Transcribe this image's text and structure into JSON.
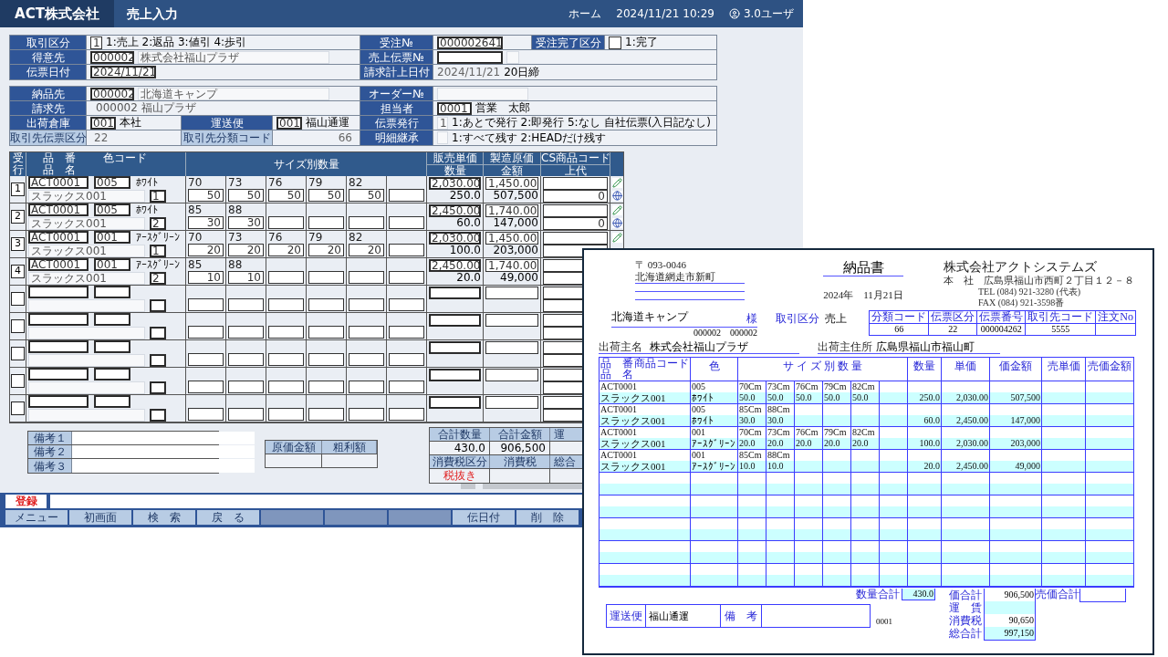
{
  "app": {
    "company": "ACT株式会社",
    "title": "売上入力",
    "home": "ホーム",
    "datetime": "2024/11/21 10:29",
    "user": "3.0ユーザ"
  },
  "order_header": {
    "transaction_type": {
      "label": "取引区分",
      "value": "1",
      "options": "1:売上  2:返品  3:値引  4:歩引"
    },
    "order_no": {
      "label": "受注№",
      "value": "000002641"
    },
    "order_complete": {
      "label": "受注完了区分",
      "options": "1:完了"
    },
    "customer": {
      "label": "得意先",
      "code": "000002",
      "name": "株式会社福山プラザ"
    },
    "sales_slip_no": {
      "label": "売上伝票№"
    },
    "slip_date": {
      "label": "伝票日付",
      "value": "2024/11/21"
    },
    "billing_date": {
      "label": "請求計上日付",
      "value": "2024/11/21",
      "closing": "20日締"
    }
  },
  "delivery": {
    "ship_to": {
      "label": "納品先",
      "code": "000002",
      "name": "北海道キャンプ"
    },
    "order_ref": {
      "label": "オーダー№"
    },
    "bill_to": {
      "label": "請求先",
      "code": "000002",
      "name": "福山プラザ"
    },
    "staff": {
      "label": "担当者",
      "code": "0001",
      "name": "営業　太郎"
    },
    "warehouse": {
      "label": "出荷倉庫",
      "code": "001",
      "name": "本社"
    },
    "carrier": {
      "label": "運送便",
      "code": "001",
      "name": "福山通運"
    },
    "slip_issue": {
      "label": "伝票発行",
      "value": "1",
      "options": "1:あとで発行 2:即発行 5:なし",
      "note": "自社伝票(入日記なし)"
    },
    "partner_slip_type": {
      "label": "取引先伝票区分",
      "value": "22"
    },
    "partner_class_code": {
      "label": "取引先分類コード",
      "value": "66"
    },
    "detail_inherit": {
      "label": "明細継承",
      "options": "1:すべて残す  2:HEADだけ残す"
    }
  },
  "grid": {
    "headers": {
      "line": "受行",
      "item_code": "品　番",
      "item_name": "品　名",
      "color_code": "色コード",
      "sizes": "サイズ別数量",
      "price": "販売単価",
      "qty": "数量",
      "cost": "製造原価",
      "amount": "金額",
      "cs_code": "CS商品コード",
      "retail": "上代"
    },
    "rows": [
      {
        "kind": "entry",
        "line": "1",
        "item_code": "ACT0001",
        "color_code": "005",
        "color_name": "ﾎﾜｲﾄ",
        "item_name": "スラックス001",
        "pattern": "1",
        "sizes": [
          {
            "size": "70",
            "qty": "50"
          },
          {
            "size": "73",
            "qty": "50"
          },
          {
            "size": "76",
            "qty": "50"
          },
          {
            "size": "79",
            "qty": "50"
          },
          {
            "size": "82",
            "qty": "50"
          }
        ],
        "price": "2,030.00",
        "qty": "250.0",
        "cost": "1,450.00",
        "amount": "507,500",
        "retail": "0",
        "icons": [
          {
            "kind": "pencil"
          },
          {
            "kind": "globe"
          }
        ]
      },
      {
        "kind": "entry",
        "line": "2",
        "item_code": "ACT0001",
        "color_code": "005",
        "color_name": "ﾎﾜｲﾄ",
        "item_name": "スラックス001",
        "pattern": "2",
        "sizes": [
          {
            "size": "85",
            "qty": "30"
          },
          {
            "size": "88",
            "qty": "30"
          }
        ],
        "price": "2,450.00",
        "qty": "60.0",
        "cost": "1,740.00",
        "amount": "147,000",
        "retail": "0",
        "icons": [
          {
            "kind": "pencil"
          },
          {
            "kind": "globe"
          }
        ]
      },
      {
        "kind": "entry",
        "line": "3",
        "item_code": "ACT0001",
        "color_code": "001",
        "color_name": "ｱｰｽｸﾞﾘｰﾝ",
        "item_name": "スラックス001",
        "pattern": "1",
        "sizes": [
          {
            "size": "70",
            "qty": "20"
          },
          {
            "size": "73",
            "qty": "20"
          },
          {
            "size": "76",
            "qty": "20"
          },
          {
            "size": "79",
            "qty": "20"
          },
          {
            "size": "82",
            "qty": "20"
          }
        ],
        "price": "2,030.00",
        "qty": "100.0",
        "cost": "1,450.00",
        "amount": "203,000",
        "icons": [
          {
            "kind": "pencil"
          }
        ]
      },
      {
        "kind": "entry",
        "line": "4",
        "item_code": "ACT0001",
        "color_code": "001",
        "color_name": "ｱｰｽｸﾞﾘｰﾝ",
        "item_name": "スラックス001",
        "pattern": "2",
        "sizes": [
          {
            "size": "85",
            "qty": "10"
          },
          {
            "size": "88",
            "qty": "10"
          }
        ],
        "price": "2,450.00",
        "qty": "20.0",
        "cost": "1,740.00",
        "amount": "49,000"
      },
      {
        "kind": "blank"
      },
      {
        "kind": "blank"
      },
      {
        "kind": "blank"
      },
      {
        "kind": "blank"
      },
      {
        "kind": "blank"
      }
    ]
  },
  "remarks": [
    {
      "label": "備考１"
    },
    {
      "label": "備考２"
    },
    {
      "label": "備考３"
    }
  ],
  "profit": {
    "cost_label": "原価金額",
    "gross_label": "粗利額"
  },
  "totals": {
    "qty_label": "合計数量",
    "qty": "430.0",
    "amount_label": "合計金額",
    "amount": "906,500",
    "freight_label": "運",
    "tax_type_label": "消費税区分",
    "tax_type": "税抜き",
    "tax_label": "消費税",
    "grand_label": "総合"
  },
  "footer": {
    "register": "登録",
    "buttons": [
      {
        "label": "メニュー",
        "disabled": false
      },
      {
        "label": "初画面",
        "disabled": false
      },
      {
        "label": "検　索",
        "disabled": false
      },
      {
        "label": "戻　る",
        "disabled": false
      },
      {
        "disabled": true
      },
      {
        "disabled": true
      },
      {
        "disabled": true
      },
      {
        "label": "伝日付",
        "disabled": false
      },
      {
        "label": "削　除",
        "disabled": false
      }
    ]
  },
  "document": {
    "postal": "〒 093-0046",
    "address": "北海道網走市新町",
    "title": "納品書",
    "date": "2024年　11月21日",
    "company": "株式会社アクトシステムズ",
    "office": "本　社　広島県福山市西町２丁目１２－８",
    "tel": "TEL (084) 921-3280 (代表)",
    "fax": "FAX (084) 921-3598番",
    "recipient": "北海道キャンプ",
    "honorific": "様",
    "codes": "000002　000002",
    "type_label": "取引区分",
    "type": "売上",
    "info_table": {
      "columns": [
        "分類コード",
        "伝票区分",
        "伝票番号",
        "取引先コード",
        "注文No"
      ],
      "values": [
        "66",
        "22",
        "000004262",
        "5555"
      ]
    },
    "shipper_label": "出荷主名",
    "shipper": "株式会社福山プラザ",
    "shipper_addr_label": "出荷主住所",
    "shipper_addr": "広島県福山市福山町",
    "table": {
      "headers": {
        "item_code": "品　番",
        "product_code": "商品コード",
        "item_name": "品　名",
        "color_label": "色",
        "sizes": "サ イ ズ 別 数 量",
        "qty": "数量",
        "price": "単価",
        "amount": "価金額",
        "sell_price": "売単価",
        "sell_amount": "売価金額"
      },
      "rows": [
        {
          "kind": "entry",
          "item_code": "ACT0001",
          "item_name": "スラックス001",
          "color_code": "005",
          "color_name": "ﾎﾜｲﾄ",
          "sizes": [
            {
              "size": "70Cm",
              "qty": "50.0"
            },
            {
              "size": "73Cm",
              "qty": "50.0"
            },
            {
              "size": "76Cm",
              "qty": "50.0"
            },
            {
              "size": "79Cm",
              "qty": "50.0"
            },
            {
              "size": "82Cm",
              "qty": "50.0"
            }
          ],
          "qty": "250.0",
          "price": "2,030.00",
          "amount": "507,500"
        },
        {
          "kind": "entry",
          "item_code": "ACT0001",
          "item_name": "スラックス001",
          "color_code": "005",
          "color_name": "ﾎﾜｲﾄ",
          "sizes": [
            {
              "size": "85Cm",
              "qty": "30.0"
            },
            {
              "size": "88Cm",
              "qty": "30.0"
            }
          ],
          "qty": "60.0",
          "price": "2,450.00",
          "amount": "147,000"
        },
        {
          "kind": "entry",
          "item_code": "ACT0001",
          "item_name": "スラックス001",
          "color_code": "001",
          "color_name": "ｱｰｽｸﾞﾘｰﾝ",
          "sizes": [
            {
              "size": "70Cm",
              "qty": "20.0"
            },
            {
              "size": "73Cm",
              "qty": "20.0"
            },
            {
              "size": "76Cm",
              "qty": "20.0"
            },
            {
              "size": "79Cm",
              "qty": "20.0"
            },
            {
              "size": "82Cm",
              "qty": "20.0"
            }
          ],
          "qty": "100.0",
          "price": "2,030.00",
          "amount": "203,000"
        },
        {
          "kind": "entry",
          "item_code": "ACT0001",
          "item_name": "スラックス001",
          "color_code": "001",
          "color_name": "ｱｰｽｸﾞﾘｰﾝ",
          "sizes": [
            {
              "size": "85Cm",
              "qty": "10.0"
            },
            {
              "size": "88Cm",
              "qty": "10.0"
            }
          ],
          "qty": "20.0",
          "price": "2,450.00",
          "amount": "49,000"
        },
        {
          "kind": "blank"
        },
        {
          "kind": "blank"
        },
        {
          "kind": "blank"
        },
        {
          "kind": "blank"
        },
        {
          "kind": "blank"
        }
      ]
    },
    "totals": {
      "qty_label": "数量合計",
      "qty": "430.0",
      "amount_label": "価合計",
      "amount": "906,500",
      "freight_label": "運　賃",
      "tax_label": "消費税",
      "tax": "90,650",
      "grand_label": "総合計",
      "grand": "997,150",
      "sell_label": "売価合計"
    },
    "carrier_label": "運送便",
    "carrier": "福山通運",
    "remarks_label": "備　考",
    "page": "0001"
  }
}
